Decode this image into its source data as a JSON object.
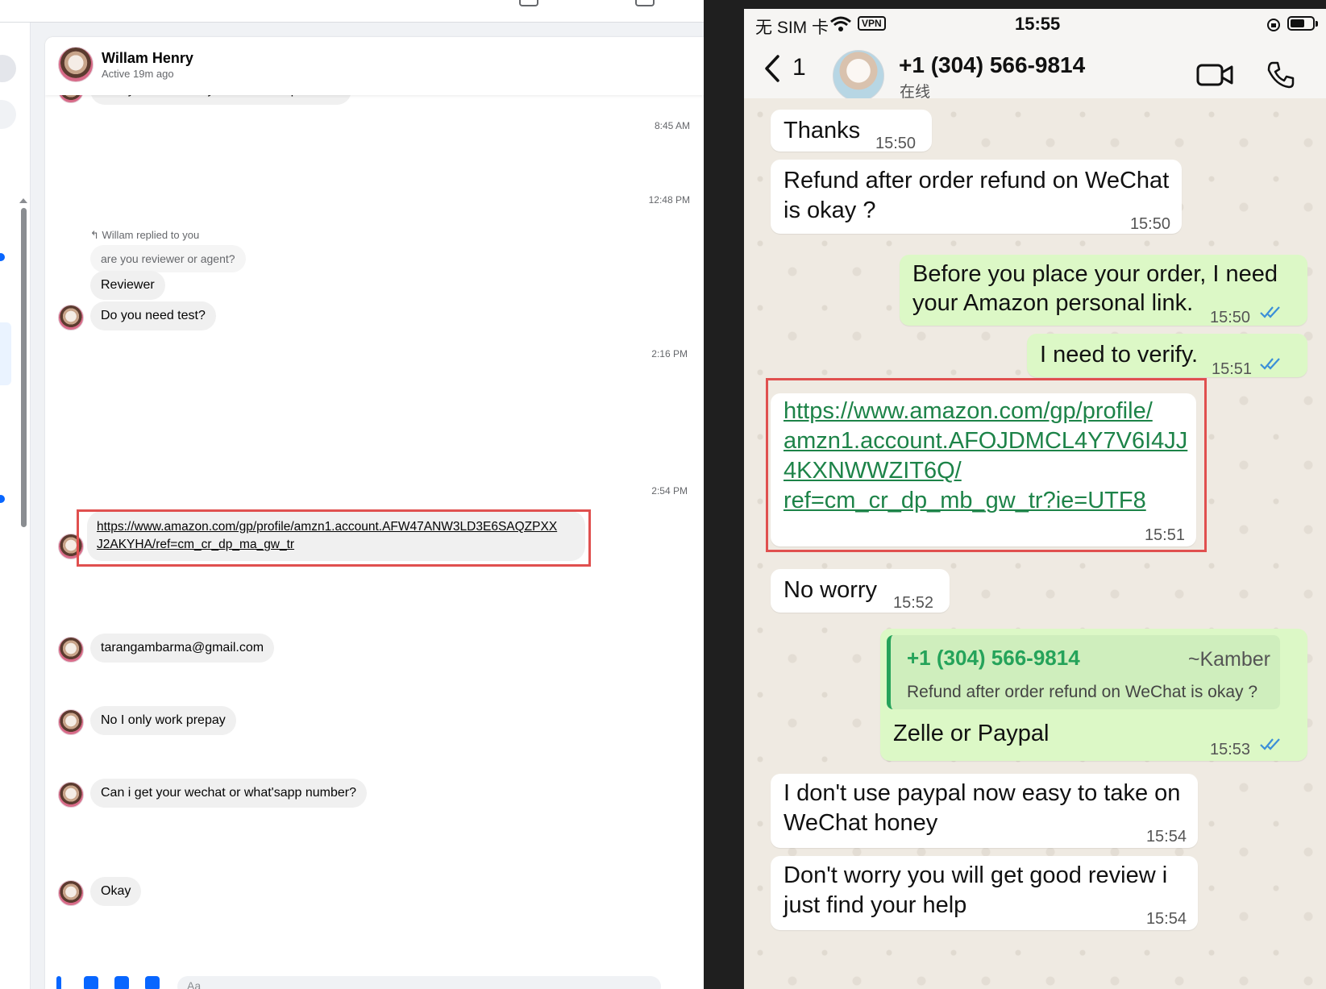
{
  "messenger": {
    "contact_name": "Willam Henry",
    "contact_status": "Active 19m ago",
    "cut_message": "Can you show me your available product?",
    "timestamps": [
      "8:45 AM",
      "12:48 PM",
      "2:16 PM",
      "2:54 PM"
    ],
    "reply_note": "Willam replied to you",
    "reply_quote": "are you reviewer or agent?",
    "messages": [
      "Reviewer",
      "Do you need test?",
      "tarangambarma@gmail.com",
      "No I only work prepay",
      "Can i get your wechat or what'sapp number?",
      "Okay"
    ],
    "link_line1": "https://www.amazon.com/gp/profile/amzn1.account.AFW47ANW3LD3E6SAQZPXX",
    "link_line2": "J2AKYHA/ref=cm_cr_dp_ma_gw_tr",
    "composer_placeholder": "Aa"
  },
  "whatsapp": {
    "status_bar": {
      "carrier": "无 SIM 卡",
      "vpn": "VPN",
      "time": "15:55"
    },
    "back_count": "1",
    "contact_number": "+1 (304) 566-9814",
    "contact_status": "在线",
    "messages": [
      {
        "text": "Thanks",
        "time": "15:50"
      },
      {
        "line1": "Refund after order refund on WeChat",
        "line2": "is okay ?",
        "time": "15:50"
      },
      {
        "line1": "Before you place your order, I need",
        "line2": "your Amazon personal link.",
        "time": "15:50"
      },
      {
        "text": "I need to verify.",
        "time": "15:51"
      },
      {
        "link_lines": [
          "https://www.amazon.com/gp/profile/",
          "amzn1.account.AFOJDMCL4Y7V6I4JJ",
          "4KXNWWZIT6Q/",
          "ref=cm_cr_dp_mb_gw_tr?ie=UTF8"
        ],
        "time": "15:51"
      },
      {
        "text": "No worry",
        "time": "15:52"
      },
      {
        "quote_name": "+1 (304) 566-9814",
        "quote_author": "~Kamber",
        "quote_text": "Refund after order refund on WeChat is okay ?",
        "text": "Zelle or Paypal",
        "time": "15:53"
      },
      {
        "line1": "I don't use paypal now easy to take on",
        "line2": "WeChat honey",
        "time": "15:54"
      },
      {
        "line1": "Don't worry you will get good review i",
        "line2": "just find your help",
        "time": "15:54"
      }
    ]
  },
  "colors": {
    "highlight_box": "#e0504f",
    "wa_outgoing": "#dcf8c6",
    "wa_link": "#1d8348",
    "read_ticks": "#3b8fd8"
  }
}
